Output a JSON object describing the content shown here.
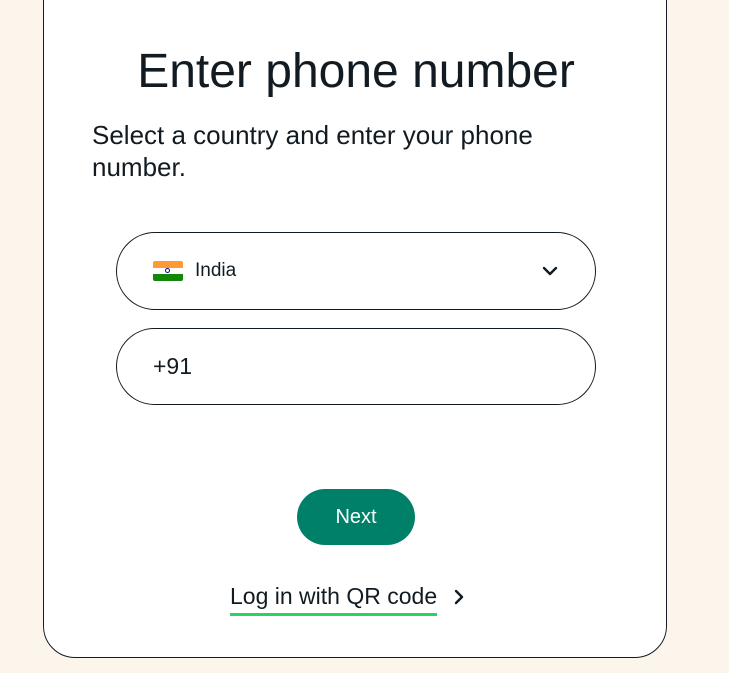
{
  "login": {
    "title": "Enter phone number",
    "subtitle": "Select a country and enter your phone number.",
    "country": {
      "selected": "India",
      "flag_icon": "india-flag-icon"
    },
    "phone": {
      "value": "+91",
      "placeholder": ""
    },
    "next_label": "Next",
    "qr_link_label": "Log in with QR code"
  },
  "colors": {
    "page_background": "#fcf5eb",
    "card_background": "#ffffff",
    "text": "#111b21",
    "primary_button": "#008069",
    "link_underline": "#25d366"
  },
  "icons": {
    "dropdown": "chevron-down-icon",
    "link_arrow": "chevron-right-icon"
  }
}
